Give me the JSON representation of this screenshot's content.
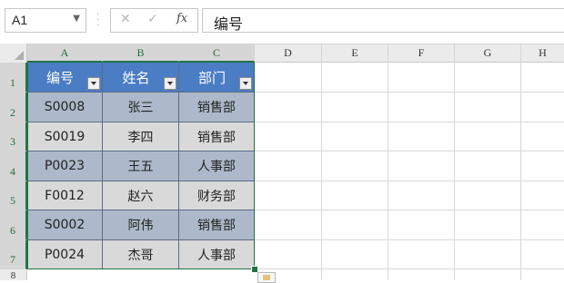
{
  "formula_bar": {
    "name_box": "A1",
    "cancel_icon": "✕",
    "enter_icon": "✓",
    "fx_label": "fx",
    "content": "编号"
  },
  "columns": [
    "A",
    "B",
    "C",
    "D",
    "E",
    "F",
    "G",
    "H"
  ],
  "rows": [
    "1",
    "2",
    "3",
    "4",
    "5",
    "6",
    "7",
    "8"
  ],
  "table": {
    "headers": [
      "编号",
      "姓名",
      "部门"
    ],
    "rows": [
      [
        "S0008",
        "张三",
        "销售部"
      ],
      [
        "S0019",
        "李四",
        "销售部"
      ],
      [
        "P0023",
        "王五",
        "人事部"
      ],
      [
        "F0012",
        "赵六",
        "财务部"
      ],
      [
        "S0002",
        "阿伟",
        "销售部"
      ],
      [
        "P0024",
        "杰哥",
        "人事部"
      ]
    ]
  },
  "colors": {
    "header_fill": "#4a7dc4",
    "band_dark": "#adb9ca",
    "band_light": "#d9d9d9",
    "selection": "#217346"
  }
}
